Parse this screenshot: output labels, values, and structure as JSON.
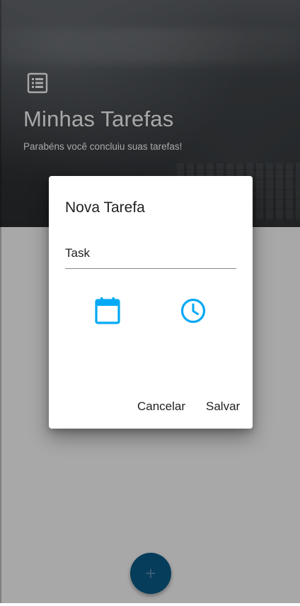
{
  "header": {
    "title": "Minhas Tarefas",
    "subtitle": "Parabéns você concluiu suas tarefas!",
    "icon": "list-alt-icon"
  },
  "dialog": {
    "title": "Nova Tarefa",
    "task_field": {
      "value": "Task",
      "placeholder": ""
    },
    "date_icon": "calendar-icon",
    "time_icon": "clock-icon",
    "cancel_label": "Cancelar",
    "save_label": "Salvar"
  },
  "fab": {
    "label": "+",
    "icon": "add-icon"
  },
  "colors": {
    "accent": "#03a9f4",
    "fab": "#0277bd",
    "text": "#222222",
    "header_text": "#ffffff"
  }
}
